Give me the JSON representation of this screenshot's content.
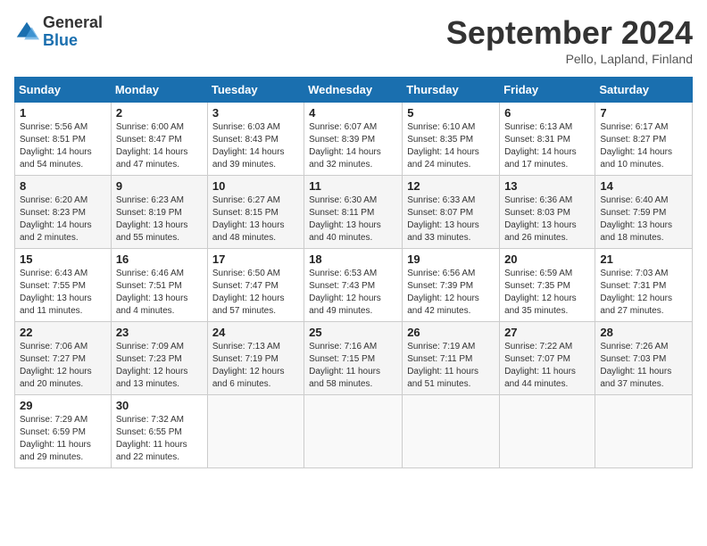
{
  "logo": {
    "general": "General",
    "blue": "Blue"
  },
  "title": "September 2024",
  "location": "Pello, Lapland, Finland",
  "days_of_week": [
    "Sunday",
    "Monday",
    "Tuesday",
    "Wednesday",
    "Thursday",
    "Friday",
    "Saturday"
  ],
  "weeks": [
    [
      {
        "day": "1",
        "sunrise": "Sunrise: 5:56 AM",
        "sunset": "Sunset: 8:51 PM",
        "daylight": "Daylight: 14 hours and 54 minutes."
      },
      {
        "day": "2",
        "sunrise": "Sunrise: 6:00 AM",
        "sunset": "Sunset: 8:47 PM",
        "daylight": "Daylight: 14 hours and 47 minutes."
      },
      {
        "day": "3",
        "sunrise": "Sunrise: 6:03 AM",
        "sunset": "Sunset: 8:43 PM",
        "daylight": "Daylight: 14 hours and 39 minutes."
      },
      {
        "day": "4",
        "sunrise": "Sunrise: 6:07 AM",
        "sunset": "Sunset: 8:39 PM",
        "daylight": "Daylight: 14 hours and 32 minutes."
      },
      {
        "day": "5",
        "sunrise": "Sunrise: 6:10 AM",
        "sunset": "Sunset: 8:35 PM",
        "daylight": "Daylight: 14 hours and 24 minutes."
      },
      {
        "day": "6",
        "sunrise": "Sunrise: 6:13 AM",
        "sunset": "Sunset: 8:31 PM",
        "daylight": "Daylight: 14 hours and 17 minutes."
      },
      {
        "day": "7",
        "sunrise": "Sunrise: 6:17 AM",
        "sunset": "Sunset: 8:27 PM",
        "daylight": "Daylight: 14 hours and 10 minutes."
      }
    ],
    [
      {
        "day": "8",
        "sunrise": "Sunrise: 6:20 AM",
        "sunset": "Sunset: 8:23 PM",
        "daylight": "Daylight: 14 hours and 2 minutes."
      },
      {
        "day": "9",
        "sunrise": "Sunrise: 6:23 AM",
        "sunset": "Sunset: 8:19 PM",
        "daylight": "Daylight: 13 hours and 55 minutes."
      },
      {
        "day": "10",
        "sunrise": "Sunrise: 6:27 AM",
        "sunset": "Sunset: 8:15 PM",
        "daylight": "Daylight: 13 hours and 48 minutes."
      },
      {
        "day": "11",
        "sunrise": "Sunrise: 6:30 AM",
        "sunset": "Sunset: 8:11 PM",
        "daylight": "Daylight: 13 hours and 40 minutes."
      },
      {
        "day": "12",
        "sunrise": "Sunrise: 6:33 AM",
        "sunset": "Sunset: 8:07 PM",
        "daylight": "Daylight: 13 hours and 33 minutes."
      },
      {
        "day": "13",
        "sunrise": "Sunrise: 6:36 AM",
        "sunset": "Sunset: 8:03 PM",
        "daylight": "Daylight: 13 hours and 26 minutes."
      },
      {
        "day": "14",
        "sunrise": "Sunrise: 6:40 AM",
        "sunset": "Sunset: 7:59 PM",
        "daylight": "Daylight: 13 hours and 18 minutes."
      }
    ],
    [
      {
        "day": "15",
        "sunrise": "Sunrise: 6:43 AM",
        "sunset": "Sunset: 7:55 PM",
        "daylight": "Daylight: 13 hours and 11 minutes."
      },
      {
        "day": "16",
        "sunrise": "Sunrise: 6:46 AM",
        "sunset": "Sunset: 7:51 PM",
        "daylight": "Daylight: 13 hours and 4 minutes."
      },
      {
        "day": "17",
        "sunrise": "Sunrise: 6:50 AM",
        "sunset": "Sunset: 7:47 PM",
        "daylight": "Daylight: 12 hours and 57 minutes."
      },
      {
        "day": "18",
        "sunrise": "Sunrise: 6:53 AM",
        "sunset": "Sunset: 7:43 PM",
        "daylight": "Daylight: 12 hours and 49 minutes."
      },
      {
        "day": "19",
        "sunrise": "Sunrise: 6:56 AM",
        "sunset": "Sunset: 7:39 PM",
        "daylight": "Daylight: 12 hours and 42 minutes."
      },
      {
        "day": "20",
        "sunrise": "Sunrise: 6:59 AM",
        "sunset": "Sunset: 7:35 PM",
        "daylight": "Daylight: 12 hours and 35 minutes."
      },
      {
        "day": "21",
        "sunrise": "Sunrise: 7:03 AM",
        "sunset": "Sunset: 7:31 PM",
        "daylight": "Daylight: 12 hours and 27 minutes."
      }
    ],
    [
      {
        "day": "22",
        "sunrise": "Sunrise: 7:06 AM",
        "sunset": "Sunset: 7:27 PM",
        "daylight": "Daylight: 12 hours and 20 minutes."
      },
      {
        "day": "23",
        "sunrise": "Sunrise: 7:09 AM",
        "sunset": "Sunset: 7:23 PM",
        "daylight": "Daylight: 12 hours and 13 minutes."
      },
      {
        "day": "24",
        "sunrise": "Sunrise: 7:13 AM",
        "sunset": "Sunset: 7:19 PM",
        "daylight": "Daylight: 12 hours and 6 minutes."
      },
      {
        "day": "25",
        "sunrise": "Sunrise: 7:16 AM",
        "sunset": "Sunset: 7:15 PM",
        "daylight": "Daylight: 11 hours and 58 minutes."
      },
      {
        "day": "26",
        "sunrise": "Sunrise: 7:19 AM",
        "sunset": "Sunset: 7:11 PM",
        "daylight": "Daylight: 11 hours and 51 minutes."
      },
      {
        "day": "27",
        "sunrise": "Sunrise: 7:22 AM",
        "sunset": "Sunset: 7:07 PM",
        "daylight": "Daylight: 11 hours and 44 minutes."
      },
      {
        "day": "28",
        "sunrise": "Sunrise: 7:26 AM",
        "sunset": "Sunset: 7:03 PM",
        "daylight": "Daylight: 11 hours and 37 minutes."
      }
    ],
    [
      {
        "day": "29",
        "sunrise": "Sunrise: 7:29 AM",
        "sunset": "Sunset: 6:59 PM",
        "daylight": "Daylight: 11 hours and 29 minutes."
      },
      {
        "day": "30",
        "sunrise": "Sunrise: 7:32 AM",
        "sunset": "Sunset: 6:55 PM",
        "daylight": "Daylight: 11 hours and 22 minutes."
      },
      null,
      null,
      null,
      null,
      null
    ]
  ]
}
